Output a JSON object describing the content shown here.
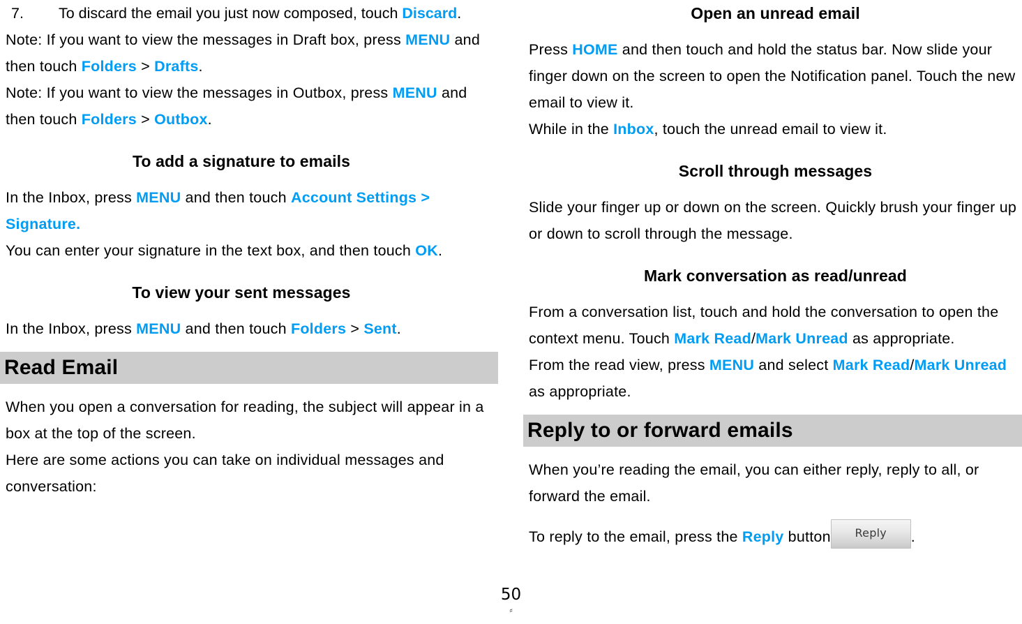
{
  "document": {
    "page_number": "50",
    "page_mark": "⸗",
    "accent_color": "#019DF4",
    "banner_color": "#CCCCCC"
  },
  "left_column": {
    "list_item": {
      "number": "7.",
      "text_before": "To discard the email you just now composed, touch ",
      "link": "Discard",
      "text_after": "."
    },
    "note_drafts": {
      "part1": "Note: If you want to view the messages in Draft box, press ",
      "link1": "MENU",
      "part2": " and then touch ",
      "link2": "Folders",
      "part3": " > ",
      "link3": "Drafts",
      "part4": "."
    },
    "note_outbox": {
      "part1": "Note: If you want to view the messages in Outbox, press ",
      "link1": "MENU",
      "part2": " and then touch ",
      "link2": "Folders",
      "part3": " > ",
      "link3": "Outbox",
      "part4": "."
    },
    "heading_signature": "To add a signature to emails",
    "signature_body": {
      "part1": "In the Inbox, press ",
      "link1": "MENU",
      "part2": " and then touch ",
      "link2": "Account Settings > Signature.",
      "part3": "\nYou can enter your signature in the text box, and then touch ",
      "link3": "OK",
      "part4": "."
    },
    "heading_sent": "To view your sent messages",
    "sent_body": {
      "part1": "In the Inbox, press ",
      "link1": "MENU",
      "part2": " and then touch ",
      "link2": "Folders",
      "part3": " > ",
      "link3": "Sent",
      "part4": "."
    },
    "banner_read_email": "Read Email",
    "read_email_body": "When you open a conversation for reading, the subject will appear in a box at the top of the screen.\nHere are some actions you can take on individual messages and conversation:"
  },
  "right_column": {
    "heading_open_unread": "Open an unread email",
    "open_unread_body": {
      "part1": "Press ",
      "link1": "HOME",
      "part2": " and then touch and hold the status bar. Now slide your finger down on the screen to open the Notification panel. Touch the new email to view it.\nWhile in the ",
      "link2": "Inbox",
      "part3": ", touch the unread email to view it."
    },
    "heading_scroll": "Scroll through messages",
    "scroll_body": "Slide your finger up or down on the screen. Quickly brush your finger up or down to scroll through the message.",
    "heading_mark": "Mark conversation as read/unread",
    "mark_body": {
      "part1": "From a conversation list, touch and hold the conversation to open the context menu. Touch ",
      "link1": "Mark Read",
      "part2": "/",
      "link2": "Mark Unread",
      "part3": " as appropriate.\nFrom the read view, press ",
      "link3": "MENU",
      "part4": " and select ",
      "link4": "Mark Read",
      "part5": "/",
      "link5": "Mark Unread",
      "part6": " as appropriate."
    },
    "banner_reply_forward": "Reply to or forward emails",
    "reply_body_1": "When you’re reading the email, you can either reply, reply to all, or forward the email.",
    "reply_body_2": {
      "part1": "To reply to the email, press the ",
      "link1": "Reply",
      "part2": " button",
      "button_label": "Reply",
      "part3": "."
    }
  }
}
